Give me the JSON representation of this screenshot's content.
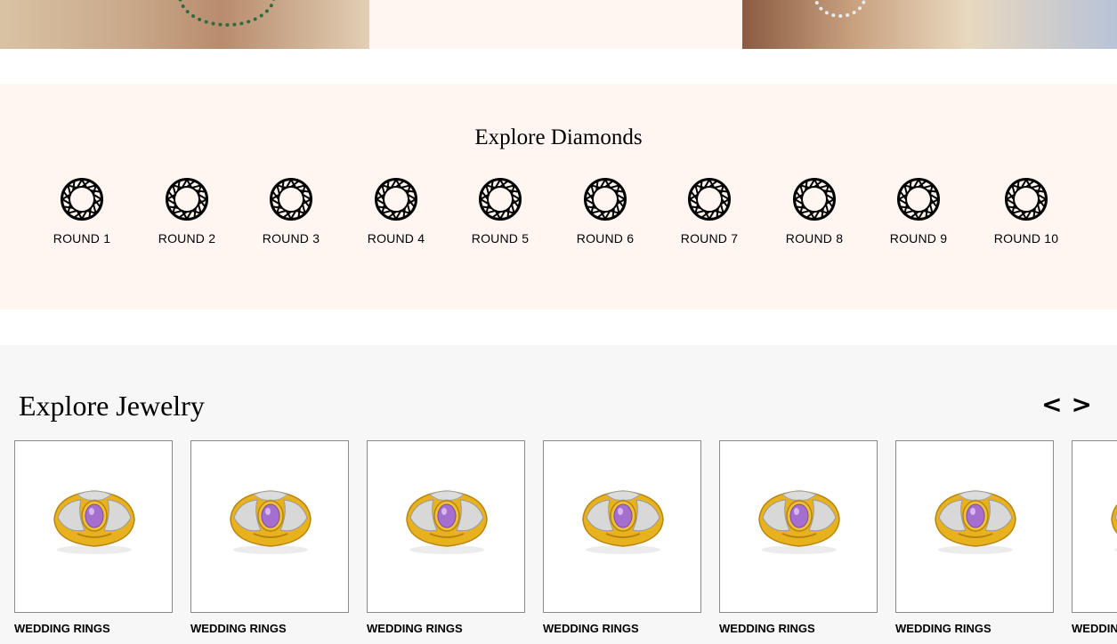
{
  "diamonds": {
    "title": "Explore Diamonds",
    "shapes": [
      {
        "label": "ROUND 1"
      },
      {
        "label": "ROUND 2"
      },
      {
        "label": "ROUND 3"
      },
      {
        "label": "ROUND 4"
      },
      {
        "label": "ROUND 5"
      },
      {
        "label": "ROUND 6"
      },
      {
        "label": "ROUND 7"
      },
      {
        "label": "ROUND 8"
      },
      {
        "label": "ROUND 9"
      },
      {
        "label": "ROUND 10"
      }
    ]
  },
  "jewelry": {
    "title": "Explore Jewelry",
    "prev_label": "<",
    "next_label": ">",
    "items": [
      {
        "label": "WEDDING RINGS"
      },
      {
        "label": "WEDDING RINGS"
      },
      {
        "label": "WEDDING RINGS"
      },
      {
        "label": "WEDDING RINGS"
      },
      {
        "label": "WEDDING RINGS"
      },
      {
        "label": "WEDDING RINGS"
      },
      {
        "label": "WEDDING RINGS"
      }
    ]
  },
  "colors": {
    "cream_background": "#fff6f1",
    "gray_background": "#f7f7f7",
    "ring_gold": "#e8b21f",
    "ring_stone": "#a56fcf"
  }
}
